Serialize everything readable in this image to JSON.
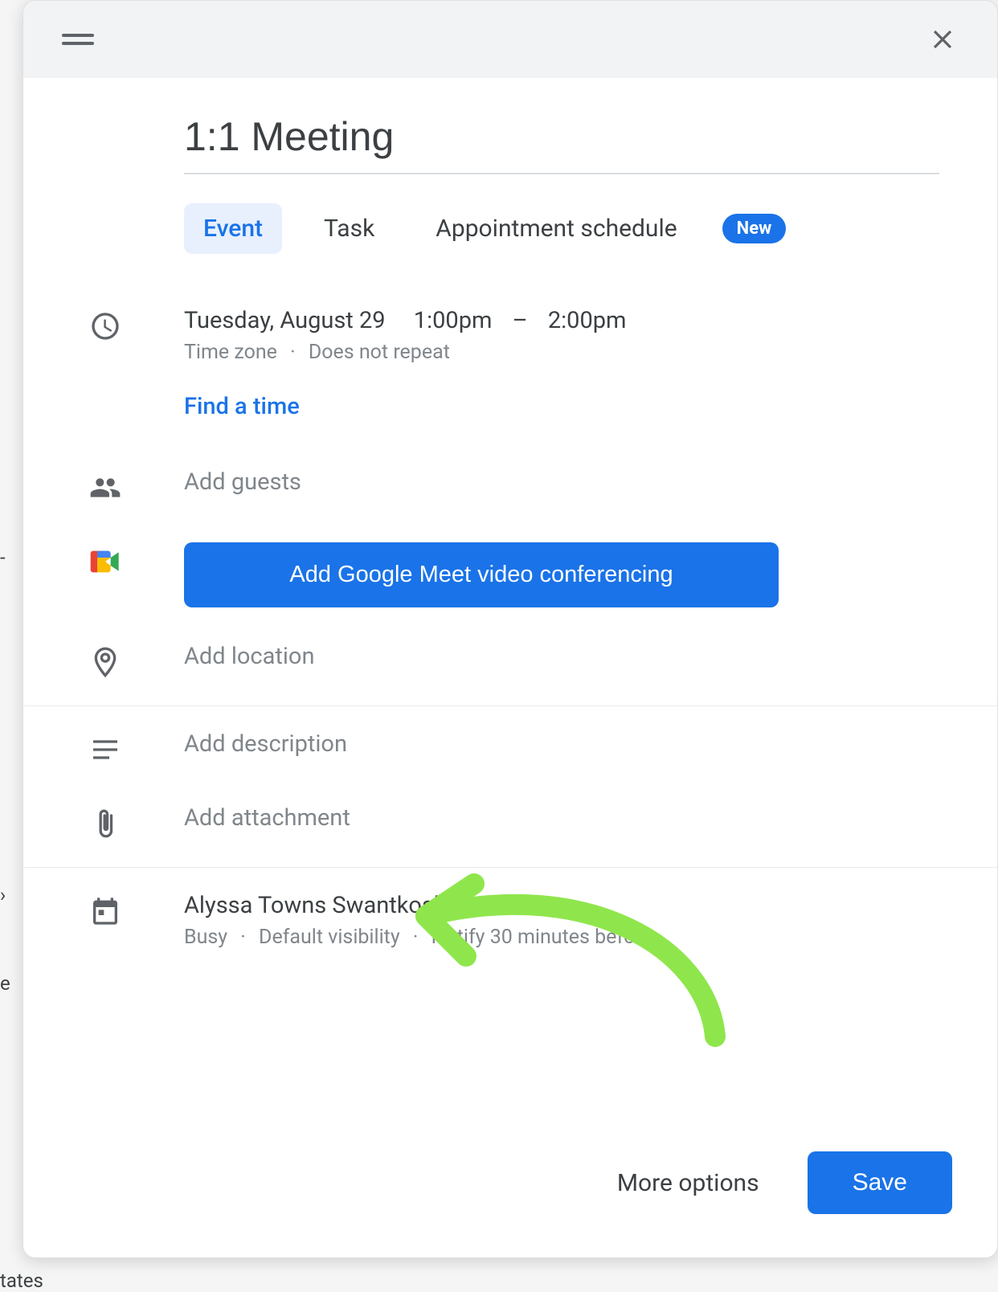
{
  "title": "1:1 Meeting",
  "tabs": {
    "event": "Event",
    "task": "Task",
    "appointment": "Appointment schedule",
    "new_badge": "New"
  },
  "time": {
    "date": "Tuesday, August 29",
    "start": "1:00pm",
    "end": "2:00pm",
    "separator": "–",
    "timezone_label": "Time zone",
    "repeat_label": "Does not repeat",
    "find_a_time": "Find a time"
  },
  "guests": {
    "placeholder": "Add guests"
  },
  "meet": {
    "button": "Add Google Meet video conferencing"
  },
  "location": {
    "placeholder": "Add location"
  },
  "description": {
    "placeholder": "Add description"
  },
  "attachment": {
    "placeholder": "Add attachment"
  },
  "organizer": {
    "name": "Alyssa Towns Swantkoski",
    "calendar_color": "#e91e63",
    "availability": "Busy",
    "visibility": "Default visibility",
    "notification": "Notify 30 minutes before"
  },
  "footer": {
    "more_options": "More options",
    "save": "Save"
  },
  "annotation": {
    "arrow_color": "#8FE64C"
  }
}
